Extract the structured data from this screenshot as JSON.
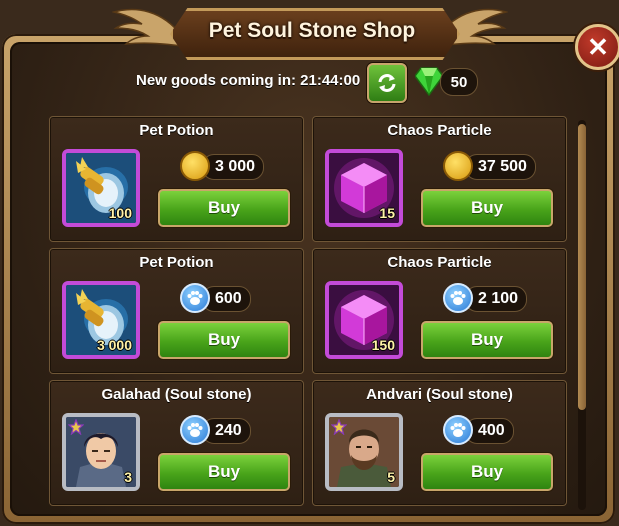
{
  "header": {
    "title": "Pet Soul Stone Shop"
  },
  "timer": {
    "label": "New goods coming in: 21:44:00"
  },
  "currency": {
    "gems": "50"
  },
  "items": [
    {
      "title": "Pet Potion",
      "qty": "100",
      "price": "3 000",
      "price_currency": "gold-coin-icon",
      "buy": "Buy"
    },
    {
      "title": "Chaos Particle",
      "qty": "15",
      "price": "37 500",
      "price_currency": "gold-coin-icon",
      "buy": "Buy"
    },
    {
      "title": "Pet Potion",
      "qty": "3 000",
      "price": "600",
      "price_currency": "pet-paw-icon",
      "buy": "Buy"
    },
    {
      "title": "Chaos Particle",
      "qty": "150",
      "price": "2 100",
      "price_currency": "pet-paw-icon",
      "buy": "Buy"
    },
    {
      "title": "Galahad (Soul stone)",
      "qty": "3",
      "price": "240",
      "price_currency": "pet-paw-icon",
      "buy": "Buy"
    },
    {
      "title": "Andvari (Soul stone)",
      "qty": "5",
      "price": "400",
      "price_currency": "pet-paw-icon",
      "buy": "Buy"
    }
  ],
  "colors": {
    "buy_green": "#49a41a",
    "frame_gold": "#c9a46a",
    "rare_purple": "#c34bd8"
  }
}
